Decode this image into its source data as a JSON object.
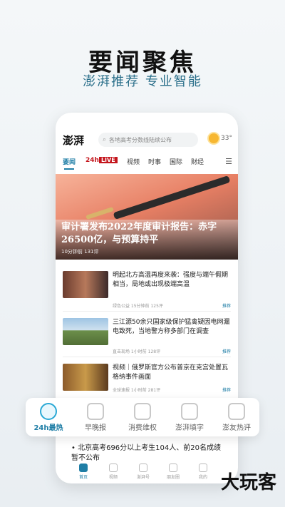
{
  "promo": {
    "title": "要闻聚焦",
    "subtitle": "澎湃推荐 专业智能"
  },
  "app": {
    "logo": "澎湃",
    "search_placeholder": "各地高考分数线陆续公布",
    "temperature": "33°",
    "weather_icon": "sun-icon"
  },
  "tabs": [
    "要闻",
    "24h",
    "LIVE",
    "视频",
    "时事",
    "国际",
    "财经"
  ],
  "hero": {
    "title": "审计署发布2022年度审计报告：赤字26500亿，与预算持平",
    "meta": "10分钟前  131评"
  },
  "news": [
    {
      "title": "明起北方高温再度来袭：强度与端午假期相当，局地或出现极端高温",
      "meta": "绿色公益  15分钟前  125评",
      "tag": "推荐"
    },
    {
      "title": "三江源50余只国家级保护猛禽疑因电网漏电致死，当地警方称多部门在调查",
      "meta": "直击现场  1小时前  128评",
      "tag": "推荐"
    },
    {
      "title": "视频｜俄罗斯官方公布普京在克宫处置瓦格纳事件画面",
      "meta": "全球速报  1小时前  281评",
      "tag": "推荐"
    }
  ],
  "features": [
    {
      "label": "24h最热",
      "icon": "clock-icon"
    },
    {
      "label": "早晚报",
      "icon": "sunrise-icon"
    },
    {
      "label": "消费维权",
      "icon": "shield-icon"
    },
    {
      "label": "澎湃填字",
      "icon": "grid-icon"
    },
    {
      "label": "澎友热评",
      "icon": "flame-icon"
    }
  ],
  "headline": "北京高考696分以上考生104人、前20名成绩暂不公布",
  "bottom_nav": [
    "首页",
    "视频",
    "澎湃号",
    "朋友圈",
    "我的"
  ],
  "watermark": "大玩客",
  "colors": {
    "accent": "#1f7ea6",
    "live_red": "#c4151c"
  }
}
